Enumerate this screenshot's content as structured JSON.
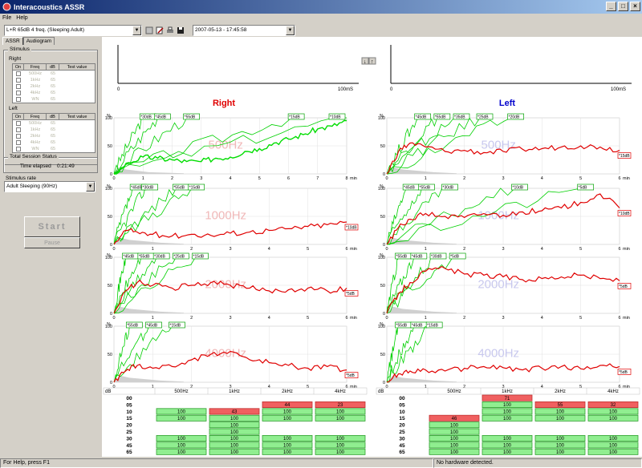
{
  "window": {
    "title": "Interacoustics ASSR",
    "buttons": [
      "_",
      "□",
      "×"
    ]
  },
  "menu": {
    "items": [
      "File",
      "Help"
    ]
  },
  "toolbar": {
    "protocol": "L+R 65dB 4 freq. (Sleeping Adult)",
    "session": "2007-05-13 - 17:45:58"
  },
  "tabs": {
    "assr": "ASSR",
    "audiogram": "Audiogram"
  },
  "stimulus": {
    "label": "Stimulus",
    "right_label": "Right",
    "left_label": "Left",
    "headers": [
      "On",
      "Freq",
      "dB",
      "Test value"
    ],
    "right_rows": [
      {
        "freq": "500Hz",
        "db": "65"
      },
      {
        "freq": "1kHz",
        "db": "65"
      },
      {
        "freq": "2kHz",
        "db": "65"
      },
      {
        "freq": "4kHz",
        "db": "65"
      },
      {
        "freq": "WN",
        "db": "65"
      }
    ],
    "left_rows": [
      {
        "freq": "500Hz",
        "db": "65"
      },
      {
        "freq": "1kHz",
        "db": "65"
      },
      {
        "freq": "2kHz",
        "db": "65"
      },
      {
        "freq": "4kHz",
        "db": "65"
      },
      {
        "freq": "WN",
        "db": "65"
      }
    ]
  },
  "session": {
    "label": "Total Session Status",
    "time_label": "Time elapsed",
    "time": "0:21:49"
  },
  "rate": {
    "label": "Stimulus rate",
    "value": "Adult Sleeping (90Hz)"
  },
  "buttons": {
    "start": "Start",
    "pause": "Pause"
  },
  "status": {
    "help": "For Help, press F1",
    "hardware": "No hardware detected."
  },
  "eeg": {
    "unit": "100mS",
    "zero": "0"
  },
  "ears": {
    "right": "Right",
    "left": "Left"
  },
  "chart_data": [
    {
      "type": "line",
      "ear": "Right",
      "frequency_label": "500Hz",
      "xlabel": "min",
      "ylabel": "%",
      "xlim": [
        0,
        8
      ],
      "ylim": [
        0,
        100
      ],
      "x_ticks": [
        "0",
        "1",
        "2",
        "3",
        "4",
        "5",
        "6",
        "7",
        "8"
      ],
      "y_ticks": [
        "0",
        "50",
        "100"
      ],
      "tags": [
        "30dB",
        "45dB",
        "55dB",
        "15dB",
        "10dB"
      ],
      "tag_x": [
        1.0,
        1.5,
        2.5,
        6.1,
        8.0
      ],
      "red_tag": "",
      "main_series": {
        "color": "#00dd00",
        "x": [
          0,
          0.5,
          1,
          1.5,
          2,
          2.5,
          3,
          3.5,
          4,
          4.5,
          5,
          5.5,
          6,
          6.5,
          7,
          7.5,
          8
        ],
        "y": [
          0,
          20,
          30,
          28,
          25,
          22,
          22,
          28,
          30,
          40,
          45,
          55,
          62,
          70,
          80,
          85,
          95
        ]
      }
    },
    {
      "type": "line",
      "ear": "Left",
      "frequency_label": "500Hz",
      "xlabel": "min",
      "ylabel": "%",
      "xlim": [
        0,
        6
      ],
      "ylim": [
        0,
        100
      ],
      "x_ticks": [
        "0",
        "1",
        "2",
        "3",
        "4",
        "5",
        "6"
      ],
      "y_ticks": [
        "0",
        "50",
        "100"
      ],
      "tags": [
        "45dB",
        "55dB",
        "35dB",
        "25dB",
        "20dB"
      ],
      "tag_x": [
        0.8,
        1.3,
        1.8,
        2.4,
        3.2
      ],
      "red_tag": "15dB",
      "main_series": {
        "color": "#e00000",
        "x": [
          0,
          0.3,
          0.6,
          1,
          1.5,
          2,
          2.5,
          3,
          3.5,
          4,
          4.5,
          5,
          5.5,
          6
        ],
        "y": [
          0,
          40,
          55,
          48,
          40,
          42,
          38,
          40,
          44,
          45,
          48,
          50,
          48,
          42
        ]
      }
    },
    {
      "type": "line",
      "ear": "Right",
      "frequency_label": "1000Hz",
      "xlabel": "min",
      "ylabel": "%",
      "xlim": [
        0,
        6
      ],
      "ylim": [
        0,
        100
      ],
      "x_ticks": [
        "0",
        "1",
        "2",
        "3",
        "4",
        "5",
        "6"
      ],
      "y_ticks": [
        "0",
        "50",
        "100"
      ],
      "tags": [
        "45dB",
        "30dB",
        "55dB",
        "15dB"
      ],
      "tag_x": [
        0.5,
        0.8,
        1.6,
        2.0
      ],
      "red_tag": "10dB",
      "main_series": {
        "color": "#e00000",
        "x": [
          0,
          0.3,
          0.6,
          1,
          1.5,
          2,
          2.5,
          3,
          3.5,
          4,
          4.5,
          5,
          5.5,
          6
        ],
        "y": [
          0,
          25,
          22,
          18,
          15,
          18,
          16,
          20,
          22,
          25,
          28,
          32,
          35,
          40
        ]
      }
    },
    {
      "type": "line",
      "ear": "Left",
      "frequency_label": "1000Hz",
      "xlabel": "min",
      "ylabel": "%",
      "xlim": [
        0,
        6
      ],
      "ylim": [
        0,
        100
      ],
      "x_ticks": [
        "0",
        "1",
        "2",
        "3",
        "4",
        "5",
        "6"
      ],
      "y_ticks": [
        "0",
        "50",
        "100"
      ],
      "tags": [
        "45dB",
        "55dB",
        "30dB",
        "10dB",
        "5dB"
      ],
      "tag_x": [
        0.5,
        0.9,
        1.5,
        3.3,
        5.0
      ],
      "red_tag": "10dB",
      "main_series": {
        "color": "#e00000",
        "x": [
          0,
          0.3,
          0.6,
          1,
          1.5,
          2,
          2.5,
          3,
          3.5,
          4,
          4.5,
          5,
          5.5,
          6
        ],
        "y": [
          0,
          30,
          45,
          55,
          50,
          48,
          55,
          52,
          58,
          60,
          65,
          75,
          90,
          65
        ]
      }
    },
    {
      "type": "line",
      "ear": "Right",
      "frequency_label": "2000Hz",
      "xlabel": "min",
      "ylabel": "%",
      "xlim": [
        0,
        6
      ],
      "ylim": [
        0,
        100
      ],
      "x_ticks": [
        "0",
        "1",
        "2",
        "3",
        "4",
        "5",
        "6"
      ],
      "y_ticks": [
        "0",
        "50",
        "100"
      ],
      "tags": [
        "45dB",
        "55dB",
        "30dB",
        "25dB",
        "15dB"
      ],
      "tag_x": [
        0.3,
        0.7,
        1.1,
        1.6,
        2.1
      ],
      "red_tag": "5dB",
      "main_series": {
        "color": "#e00000",
        "x": [
          0,
          0.3,
          0.6,
          1,
          1.5,
          2,
          2.5,
          3,
          3.5,
          4,
          4.5,
          5,
          5.5,
          6
        ],
        "y": [
          0,
          40,
          55,
          50,
          45,
          50,
          55,
          50,
          45,
          40,
          42,
          45,
          40,
          45
        ]
      }
    },
    {
      "type": "line",
      "ear": "Left",
      "frequency_label": "2000Hz",
      "xlabel": "min",
      "ylabel": "%",
      "xlim": [
        0,
        6
      ],
      "ylim": [
        0,
        100
      ],
      "x_ticks": [
        "0",
        "1",
        "2",
        "3",
        "4",
        "5",
        "6"
      ],
      "y_ticks": [
        "0",
        "50",
        "100"
      ],
      "tags": [
        "55dB",
        "45dB",
        "30dB",
        "5dB"
      ],
      "tag_x": [
        0.3,
        0.7,
        1.2,
        1.7
      ],
      "red_tag": "5dB",
      "main_series": {
        "color": "#e00000",
        "x": [
          0,
          0.3,
          0.6,
          1,
          1.5,
          2,
          2.5,
          3,
          3.5,
          4,
          4.5,
          5,
          5.5,
          6
        ],
        "y": [
          0,
          35,
          55,
          75,
          80,
          70,
          68,
          65,
          60,
          62,
          65,
          68,
          62,
          58
        ]
      }
    },
    {
      "type": "line",
      "ear": "Right",
      "frequency_label": "4000Hz",
      "xlabel": "min",
      "ylabel": "%",
      "xlim": [
        0,
        6
      ],
      "ylim": [
        0,
        100
      ],
      "x_ticks": [
        "0",
        "1",
        "2",
        "3",
        "4",
        "5",
        "6"
      ],
      "y_ticks": [
        "0",
        "50",
        "100"
      ],
      "tags": [
        "55dB",
        "45dB",
        "15dB"
      ],
      "tag_x": [
        0.4,
        0.9,
        1.5
      ],
      "red_tag": "5dB",
      "main_series": {
        "color": "#e00000",
        "x": [
          0,
          0.3,
          0.6,
          1,
          1.5,
          2,
          2.5,
          3,
          3.5,
          4,
          4.5,
          5,
          5.5,
          6
        ],
        "y": [
          0,
          20,
          30,
          25,
          28,
          40,
          50,
          55,
          40,
          35,
          30,
          25,
          28,
          22
        ]
      }
    },
    {
      "type": "line",
      "ear": "Left",
      "frequency_label": "4000Hz",
      "xlabel": "min",
      "ylabel": "%",
      "xlim": [
        0,
        6
      ],
      "ylim": [
        0,
        100
      ],
      "x_ticks": [
        "0",
        "1",
        "2",
        "3",
        "4",
        "5",
        "6"
      ],
      "y_ticks": [
        "0",
        "50",
        "100"
      ],
      "tags": [
        "55dB",
        "45dB",
        "15dB"
      ],
      "tag_x": [
        0.3,
        0.7,
        1.1
      ],
      "red_tag": "5dB",
      "main_series": {
        "color": "#e00000",
        "x": [
          0,
          0.3,
          0.6,
          1,
          1.5,
          2,
          2.5,
          3,
          3.5,
          4,
          4.5,
          5,
          5.5,
          6
        ],
        "y": [
          0,
          15,
          20,
          22,
          20,
          25,
          28,
          26,
          22,
          25,
          28,
          24,
          30,
          28
        ]
      }
    }
  ],
  "results": {
    "header_db": "dB",
    "freqs": [
      "500Hz",
      "1kHz",
      "2kHz",
      "4kHz"
    ],
    "levels": [
      "00",
      "05",
      "10",
      "15",
      "20",
      "25",
      "30",
      "45",
      "65"
    ],
    "right": [
      [
        "",
        "",
        "",
        ""
      ],
      [
        "",
        "",
        "44",
        "23"
      ],
      [
        "100",
        "43",
        "100",
        "100"
      ],
      [
        "100",
        "100",
        "100",
        "100"
      ],
      [
        "",
        "100",
        "",
        ""
      ],
      [
        "",
        "100",
        "",
        ""
      ],
      [
        "100",
        "100",
        "100",
        "100"
      ],
      [
        "100",
        "100",
        "100",
        "100"
      ],
      [
        "100",
        "100",
        "100",
        "100"
      ]
    ],
    "left": [
      [
        "",
        "71",
        "",
        ""
      ],
      [
        "",
        "100",
        "55",
        "32"
      ],
      [
        "",
        "100",
        "100",
        "100"
      ],
      [
        "46",
        "100",
        "100",
        "100"
      ],
      [
        "100",
        "",
        "",
        ""
      ],
      [
        "100",
        "",
        "",
        ""
      ],
      [
        "100",
        "100",
        "100",
        "100"
      ],
      [
        "100",
        "100",
        "100",
        "100"
      ],
      [
        "100",
        "100",
        "100",
        "100"
      ]
    ],
    "red_cells": {
      "right": [
        [
          1,
          2
        ],
        [
          1,
          3
        ],
        [
          2,
          1
        ]
      ],
      "left": [
        [
          0,
          1
        ],
        [
          1,
          2
        ],
        [
          1,
          3
        ],
        [
          3,
          0
        ]
      ]
    }
  },
  "colors": {
    "green": "#00e000",
    "red": "#e00000",
    "bluelabel": "#0000cc"
  }
}
